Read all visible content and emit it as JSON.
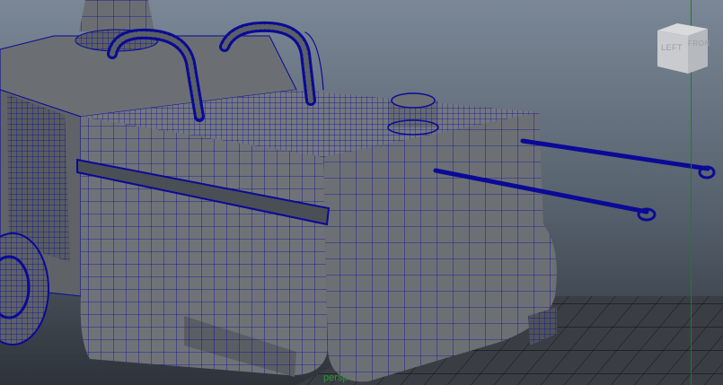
{
  "viewport": {
    "camera_name": "persp",
    "background_top": "#7a8796",
    "background_bottom": "#2e333a",
    "wireframe_color": "#0a0a96",
    "surface_color": "#6f7378",
    "grid_color": "#000000",
    "axis_color": "#1f7a2a"
  },
  "view_cube": {
    "left_label": "LEFT",
    "front_label": "FRON"
  }
}
